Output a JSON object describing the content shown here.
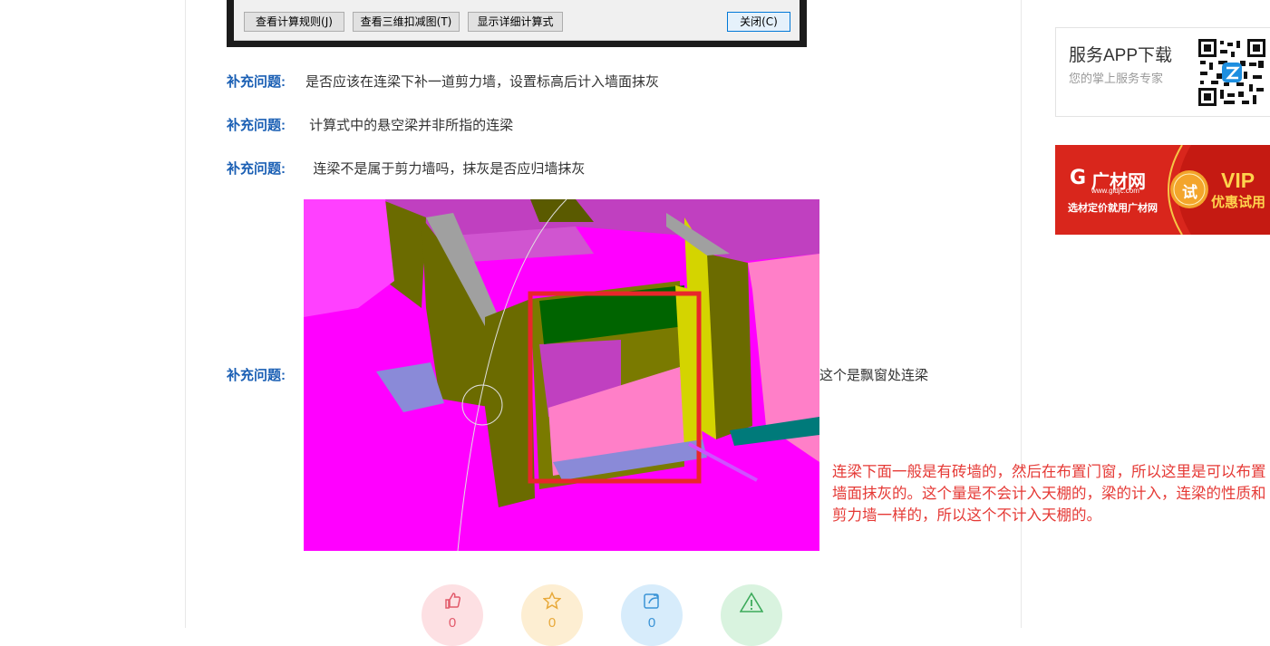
{
  "dialog": {
    "btn_rules": "查看计算规则(J)",
    "btn_3d": "查看三维扣减图(T)",
    "btn_detail": "显示详细计算式",
    "btn_close": "关闭(C)"
  },
  "questions": [
    {
      "label": "补充问题:",
      "text": "是否应该在连梁下补一道剪力墙，设置标高后计入墙面抹灰"
    },
    {
      "label": "补充问题:",
      "text": " 计算式中的悬空梁并非所指的连梁"
    },
    {
      "label": "补充问题:",
      "text": "  连梁不是属于剪力墙吗，抹灰是否应归墙抹灰"
    },
    {
      "label": "补充问题:",
      "text": "这个是飘窗处连梁"
    }
  ],
  "annotation": "连梁下面一般是有砖墙的，然后在布置门窗，所以这里是可以布置墙面抹灰的。这个量是不会计入天棚的，梁的计入，连梁的性质和剪力墙一样的，所以这个不计入天棚的。",
  "actions": [
    {
      "icon": "thumb-up-icon",
      "count": "0",
      "bg": "#fde0e3",
      "fg": "#e25a6b"
    },
    {
      "icon": "star-icon",
      "count": "0",
      "bg": "#fdeed2",
      "fg": "#e8a93a"
    },
    {
      "icon": "share-icon",
      "count": "0",
      "bg": "#d7ecfb",
      "fg": "#3a93d6"
    },
    {
      "icon": "warning-icon",
      "count": "",
      "bg": "#d9f3df",
      "fg": "#3caa5a"
    }
  ],
  "sidebar": {
    "app_title": "服务APP下载",
    "app_sub": "您的掌上服务专家",
    "banner_logo": "广材网",
    "banner_url": "www.gldjc.com",
    "banner_slogan": "选材定价就用广材网",
    "banner_try": "试",
    "banner_vip": "VIP",
    "banner_vip_sub": "优惠试用"
  },
  "colors": {
    "label_blue": "#1a5fb4",
    "annotation_red": "#e53935",
    "banner_red": "#d9261c"
  }
}
